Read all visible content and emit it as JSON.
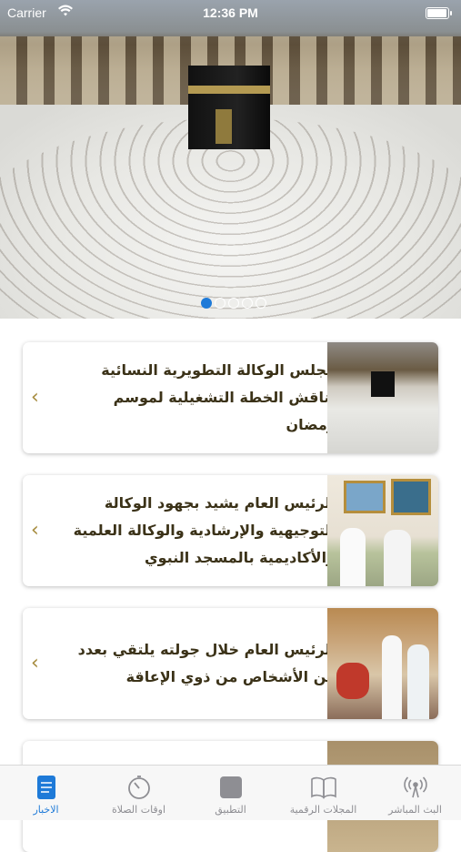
{
  "status_bar": {
    "carrier": "Carrier",
    "time": "12:36 PM"
  },
  "hero": {
    "slide_count": 5,
    "active_slide": 1
  },
  "news": [
    {
      "title": "مجلس الوكالة التطويرية النسائية يناقش الخطة التشغيلية لموسم رمضان"
    },
    {
      "title": "الرئيس العام يشيد بجهود الوكالة التوجيهية والإرشادية والوكالة العلمية والأكاديمية بالمسجد النبوي"
    },
    {
      "title": "الرئيس العام خلال جولته يلتقي بعدد من الأشخاص من ذوي الإعاقة"
    },
    {
      "title": ""
    }
  ],
  "tabs": [
    {
      "label": "البث المباشر",
      "icon": "broadcast-icon"
    },
    {
      "label": "المجلات الرقمية",
      "icon": "book-icon"
    },
    {
      "label": "التطبيق",
      "icon": "app-square-icon"
    },
    {
      "label": "اوقات الصلاة",
      "icon": "stopwatch-icon"
    },
    {
      "label": "الاخبار",
      "icon": "news-document-icon"
    }
  ],
  "colors": {
    "accent": "#1e7ad8",
    "title_text": "#3b3218",
    "chevron": "#a58a3c"
  }
}
